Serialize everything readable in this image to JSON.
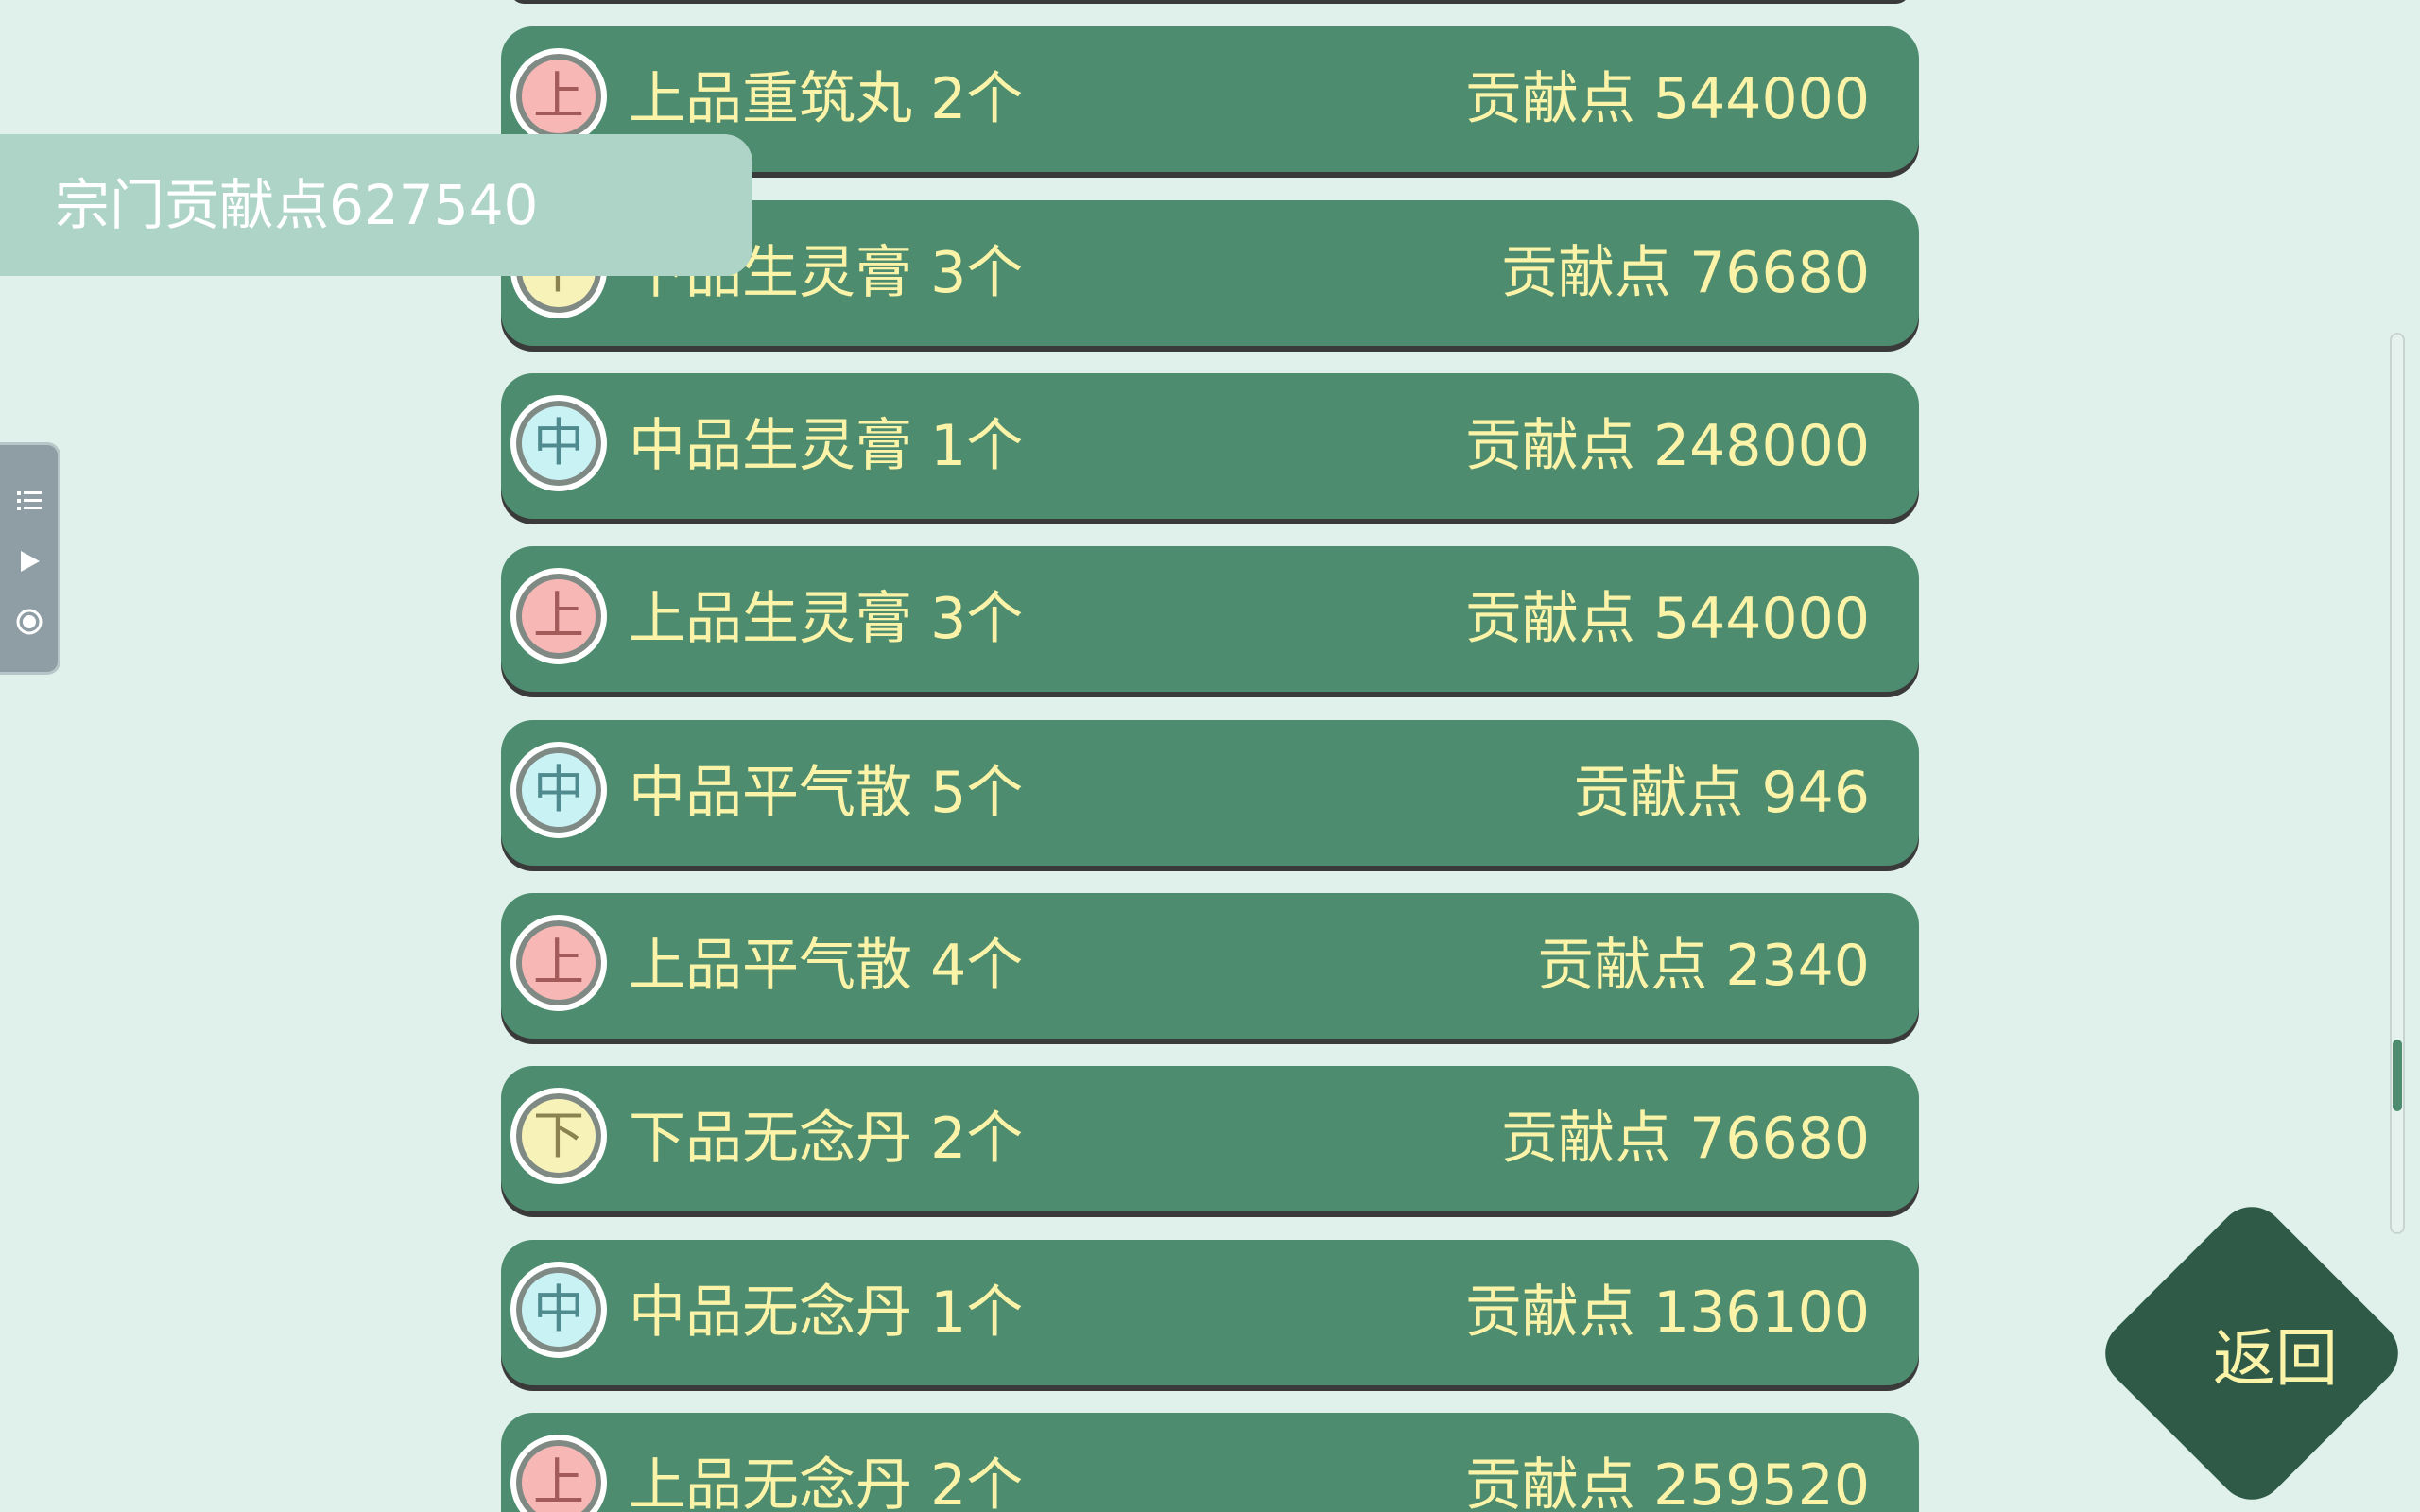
{
  "contribution_label": "宗门贡献点627540",
  "back_label": "返回",
  "items": [
    {
      "grade": "上",
      "grade_class": "g-up",
      "name": "上品重筑丸 2个",
      "cost": "贡献点 544000"
    },
    {
      "grade": "下",
      "grade_class": "g-low",
      "name": "下品生灵膏 3个",
      "cost": "贡献点 76680"
    },
    {
      "grade": "中",
      "grade_class": "g-mid",
      "name": "中品生灵膏 1个",
      "cost": "贡献点 248000"
    },
    {
      "grade": "上",
      "grade_class": "g-up",
      "name": "上品生灵膏 3个",
      "cost": "贡献点 544000"
    },
    {
      "grade": "中",
      "grade_class": "g-mid",
      "name": "中品平气散 5个",
      "cost": "贡献点 946"
    },
    {
      "grade": "上",
      "grade_class": "g-up",
      "name": "上品平气散 4个",
      "cost": "贡献点 2340"
    },
    {
      "grade": "下",
      "grade_class": "g-low",
      "name": "下品无念丹 2个",
      "cost": "贡献点 76680"
    },
    {
      "grade": "中",
      "grade_class": "g-mid",
      "name": "中品无念丹 1个",
      "cost": "贡献点 136100"
    },
    {
      "grade": "上",
      "grade_class": "g-up",
      "name": "上品无念丹 2个",
      "cost": "贡献点 259520"
    }
  ],
  "float_bar": {
    "icons": [
      "list-icon",
      "play-icon",
      "record-icon"
    ]
  },
  "scroll": {
    "position": 0.84
  },
  "colors": {
    "background": "#e0f0ea",
    "row": "#4d8c6e",
    "text": "#fbf3a8",
    "back_button": "#2f5a48"
  }
}
